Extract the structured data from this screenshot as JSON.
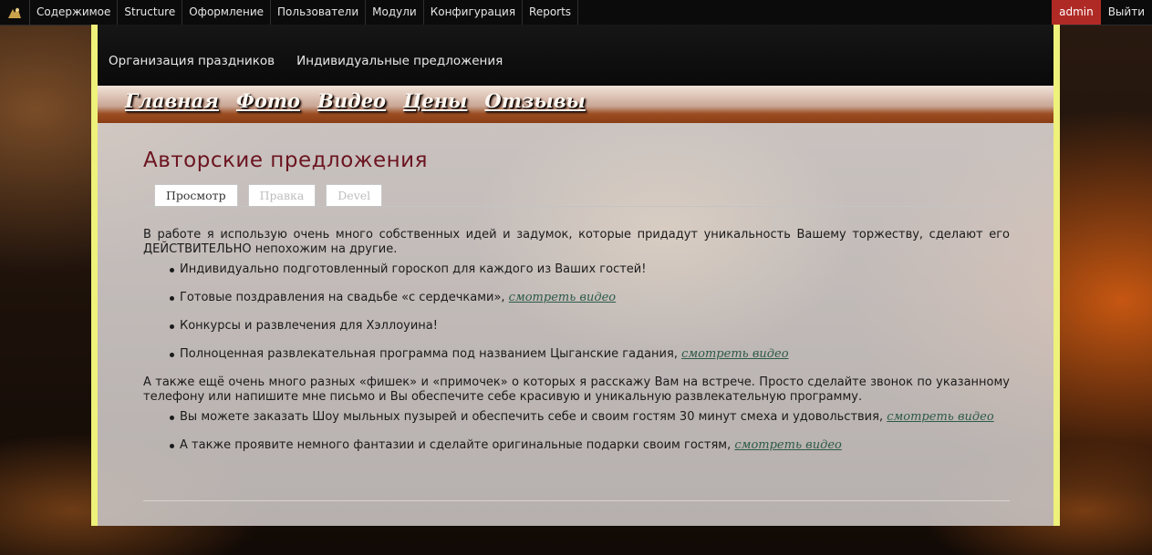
{
  "admin_bar": {
    "menu": [
      "Содержимое",
      "Structure",
      "Оформление",
      "Пользователи",
      "Модули",
      "Конфигурация",
      "Reports"
    ],
    "user": "admin",
    "logout": "Выйти"
  },
  "header": {
    "links": [
      "Организация праздников",
      "Индивидуальные предложения"
    ]
  },
  "nav": {
    "items": [
      "Главная",
      "Фото",
      "Видео",
      "Цены",
      "Отзывы"
    ]
  },
  "page": {
    "title": "Авторские предложения",
    "tabs": [
      "Просмотр",
      "Правка",
      "Devel"
    ],
    "active_tab": "Просмотр",
    "intro": "В работе я использую очень много собственных идей и задумок, которые придадут уникальность Вашему торжеству, сделают его ДЕЙСТВИТЕЛЬНО непохожим на другие.",
    "list1": [
      {
        "text": "Индивидуально подготовленный гороскоп для каждого из Ваших гостей!",
        "link": ""
      },
      {
        "text": "Готовые поздравления на свадьбе «с сердечками», ",
        "link": "смотреть видео"
      },
      {
        "text": "Конкурсы и развлечения для Хэллоуина!",
        "link": ""
      },
      {
        "text": "Полноценная развлекательная программа под названием Цыганские гадания, ",
        "link": "смотреть видео"
      }
    ],
    "middle": "А также ещё очень много разных «фишек» и «примочек» о которых я расскажу Вам на встрече. Просто сделайте звонок по указанному телефону или напишите мне письмо и Вы обеспечите себе красивую и уникальную развлекательную программу.",
    "list2": [
      {
        "text": "Вы можете заказать Шоу мыльных пузырей и обеспечить себе и своим гостям 30 минут смеха и удовольствия, ",
        "link": "смотреть видео"
      },
      {
        "text": "А также проявите немного фантазии и сделайте оригинальные подарки своим гостям, ",
        "link": "смотреть видео"
      }
    ]
  },
  "colors": {
    "border_accent": "#eef17a",
    "title": "#6b1420",
    "admin_user_bg": "#b02a25"
  }
}
